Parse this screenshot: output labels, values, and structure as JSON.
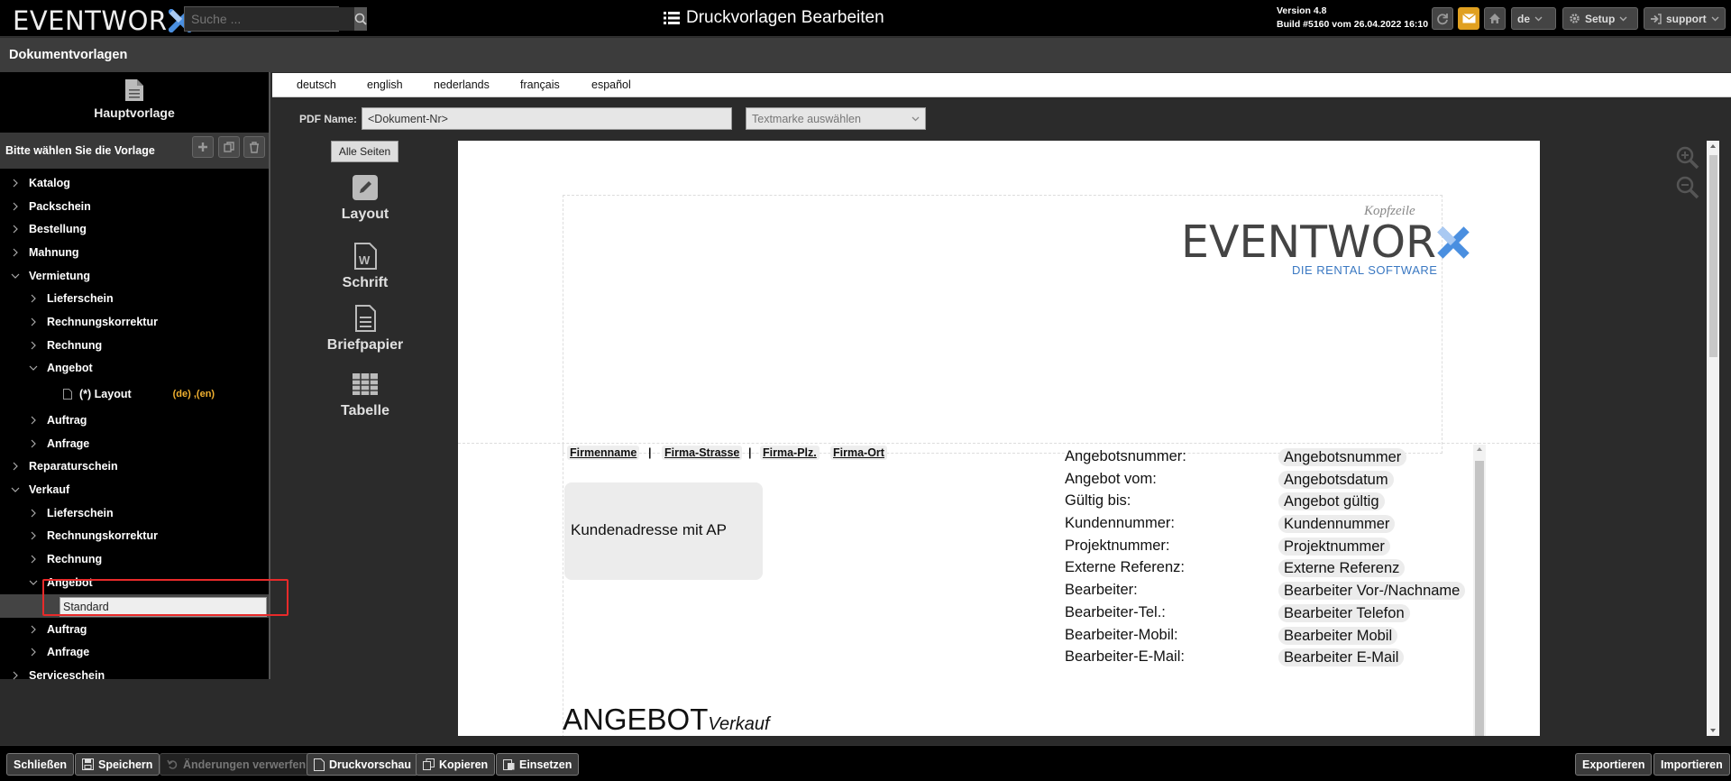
{
  "app": {
    "brand": "EVENTWOR",
    "title": "Druckvorlagen Bearbeiten",
    "version": "Version 4.8",
    "build": "Build #5160 vom 26.04.2022 16:10",
    "search_placeholder": "Suche ...",
    "lang_select": "de",
    "setup_label": "Setup",
    "user_label": "support",
    "accent_color": "#f0b030"
  },
  "section_title": "Dokumentvorlagen",
  "sidebar": {
    "main_template": "Hauptvorlage",
    "choose_label": "Bitte wählen Sie die Vorlage",
    "tree": [
      {
        "label": "Katalog",
        "level": 0,
        "expanded": false
      },
      {
        "label": "Packschein",
        "level": 0,
        "expanded": false
      },
      {
        "label": "Bestellung",
        "level": 0,
        "expanded": false
      },
      {
        "label": "Mahnung",
        "level": 0,
        "expanded": false
      },
      {
        "label": "Vermietung",
        "level": 0,
        "expanded": true
      },
      {
        "label": "Lieferschein",
        "level": 1,
        "expanded": false
      },
      {
        "label": "Rechnungskorrektur",
        "level": 1,
        "expanded": false
      },
      {
        "label": "Rechnung",
        "level": 1,
        "expanded": false
      },
      {
        "label": "Angebot",
        "level": 1,
        "expanded": true
      },
      {
        "label": "(*) Layout",
        "level": 2,
        "langs": "(de) ,(en)"
      },
      {
        "label": "Auftrag",
        "level": 1,
        "expanded": false
      },
      {
        "label": "Anfrage",
        "level": 1,
        "expanded": false
      },
      {
        "label": "Reparaturschein",
        "level": 0,
        "expanded": false
      },
      {
        "label": "Verkauf",
        "level": 0,
        "expanded": true
      },
      {
        "label": "Lieferschein",
        "level": 1,
        "expanded": false
      },
      {
        "label": "Rechnungskorrektur",
        "level": 1,
        "expanded": false
      },
      {
        "label": "Rechnung",
        "level": 1,
        "expanded": false
      },
      {
        "label": "Angebot",
        "level": 1,
        "expanded": true
      },
      {
        "edit_value": "Standard",
        "level": 2,
        "editing": true
      },
      {
        "label": "Auftrag",
        "level": 1,
        "expanded": false
      },
      {
        "label": "Anfrage",
        "level": 1,
        "expanded": false
      },
      {
        "label": "Serviceschein",
        "level": 0,
        "expanded": false
      }
    ]
  },
  "languages": [
    "deutsch",
    "english",
    "nederlands",
    "français",
    "español"
  ],
  "pdf": {
    "label": "PDF Name:",
    "value": "<Dokument-Nr>",
    "textmark_placeholder": "Textmarke auswählen"
  },
  "tools": {
    "all_pages": "Alle Seiten",
    "items": [
      "Layout",
      "Schrift",
      "Briefpapier",
      "Tabelle"
    ]
  },
  "document": {
    "header_label": "Kopfzeile",
    "logo_text": "EVENTWOR",
    "logo_sub": "DIE RENTAL SOFTWARE",
    "sender_fields": [
      "Firmenname",
      "Firma-Strasse",
      "Firma-Plz.",
      "Firma-Ort"
    ],
    "sender_sep": "|",
    "address_box": "Kundenadresse mit AP",
    "fields": [
      {
        "label": "Angebotsnummer:",
        "value": "Angebotsnummer"
      },
      {
        "label": "Angebot vom:",
        "value": "Angebotsdatum"
      },
      {
        "label": "Gültig bis:",
        "value": "Angebot gültig"
      },
      {
        "label": "Kundennummer:",
        "value": "Kundennummer"
      },
      {
        "label": "Projektnummer:",
        "value": "Projektnummer"
      },
      {
        "label": "Externe Referenz:",
        "value": "Externe Referenz"
      },
      {
        "label": "Bearbeiter:",
        "value": "Bearbeiter Vor-/Nachname"
      },
      {
        "label": "Bearbeiter-Tel.:",
        "value": "Bearbeiter Telefon"
      },
      {
        "label": "Bearbeiter-Mobil:",
        "value": "Bearbeiter Mobil"
      },
      {
        "label": "Bearbeiter-E-Mail:",
        "value": "Bearbeiter E-Mail"
      }
    ],
    "doc_title": "ANGEBOT",
    "doc_subtitle": "Verkauf"
  },
  "bottom": {
    "close": "Schließen",
    "save": "Speichern",
    "discard": "Änderungen verwerfen",
    "preview": "Druckvorschau",
    "copy": "Kopieren",
    "paste": "Einsetzen",
    "export": "Exportieren",
    "import": "Importieren"
  }
}
